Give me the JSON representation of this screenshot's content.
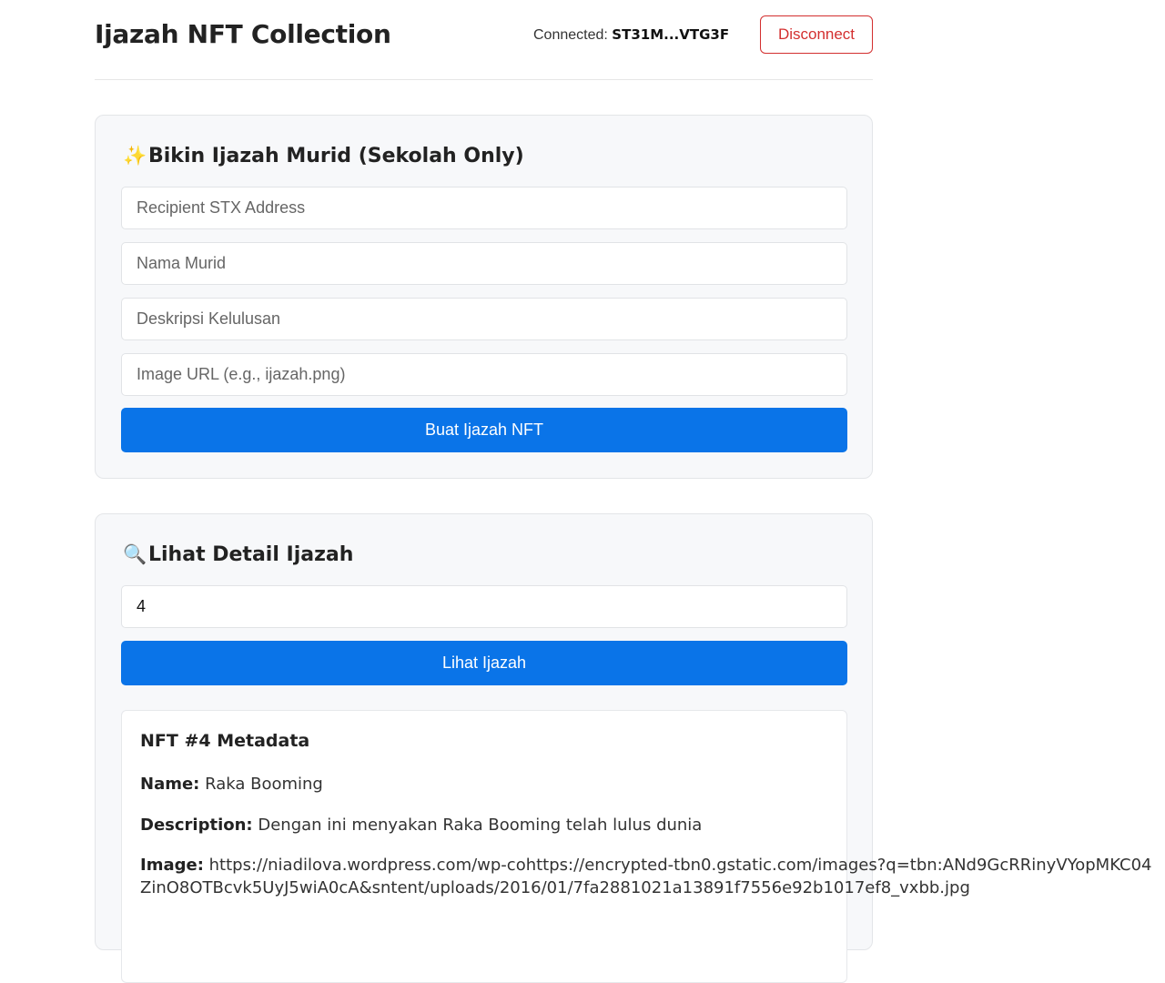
{
  "header": {
    "title": "Ijazah NFT Collection",
    "connected_label": "Connected:",
    "connected_address": "ST31M...VTG3F",
    "disconnect_label": "Disconnect"
  },
  "mint": {
    "emoji": "✨",
    "title": "Bikin Ijazah Murid (Sekolah Only)",
    "recipient_placeholder": "Recipient STX Address",
    "name_placeholder": "Nama Murid",
    "description_placeholder": "Deskripsi Kelulusan",
    "image_placeholder": "Image URL (e.g., ijazah.png)",
    "submit_label": "Buat Ijazah NFT"
  },
  "view": {
    "emoji": "🔍",
    "title": "Lihat Detail Ijazah",
    "token_id_value": "4",
    "submit_label": "Lihat Ijazah"
  },
  "metadata": {
    "title": "NFT #4 Metadata",
    "name_label": "Name:",
    "name_value": "Raka Booming",
    "description_label": "Description:",
    "description_value": "Dengan ini menyakan Raka Booming telah lulus dunia",
    "image_label": "Image:",
    "image_value": "https://niadilova.wordpress.com/wp-cohttps://encrypted-tbn0.gstatic.com/images?q=tbn:ANd9GcRRinyVYopMKC04ZinO8OTBcvk5UyJ5wiA0cA&sntent/uploads/2016/01/7fa2881021a13891f7556e92b1017ef8_vxbb.jpg"
  }
}
